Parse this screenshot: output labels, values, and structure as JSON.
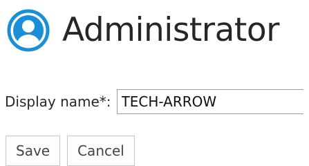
{
  "header": {
    "avatar_icon": "user-circle-icon",
    "title": "Administrator",
    "accent_color": "#1a8fd8"
  },
  "form": {
    "display_name_label": "Display name*:",
    "display_name_value": "TECH-ARROW"
  },
  "actions": {
    "save_label": "Save",
    "cancel_label": "Cancel"
  }
}
